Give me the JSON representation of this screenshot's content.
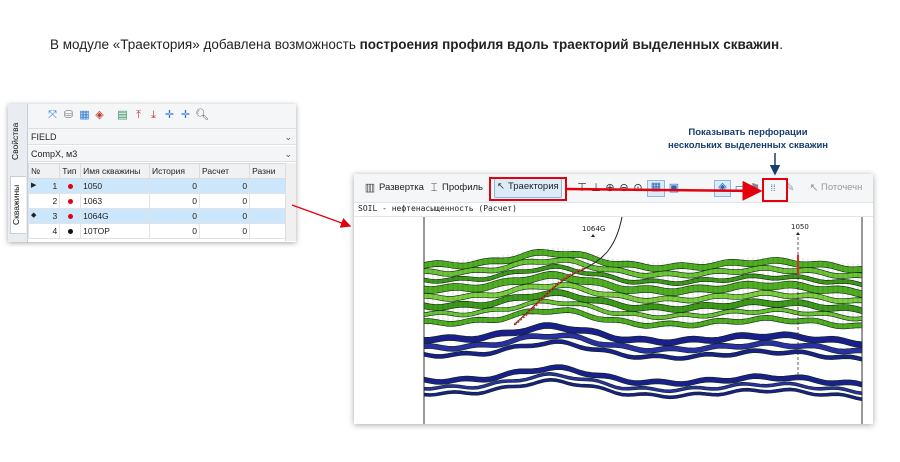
{
  "headline": {
    "prefix": "В модуле «Траектория» добавлена возможность ",
    "bold": "построения профиля вдоль траекторий выделенных скважин",
    "suffix": "."
  },
  "wells_panel": {
    "tabs": {
      "properties": "Свойства",
      "wells": "Скважины"
    },
    "combo_field": "FIELD",
    "combo_property": "CompX, м3",
    "columns": {
      "no": "№",
      "type": "Тип",
      "name": "Имя скважины",
      "history": "История",
      "calc": "Расчет",
      "diff": "Разни"
    },
    "rows": [
      {
        "no": "1",
        "name": "1050",
        "history": "0",
        "calc": "0",
        "dot_color": "#e3000f"
      },
      {
        "no": "2",
        "name": "1063",
        "history": "0",
        "calc": "0",
        "dot_color": "#e3000f"
      },
      {
        "no": "3",
        "name": "1064G",
        "history": "0",
        "calc": "0",
        "dot_color": "#e3000f"
      },
      {
        "no": "4",
        "name": "10TOP",
        "history": "0",
        "calc": "0",
        "dot_color": "#111111"
      }
    ]
  },
  "profile": {
    "toolbar": {
      "sweep": "Развертка",
      "profile": "Профиль",
      "trajectory": "Траектория",
      "streamlines": "Поточечн"
    },
    "property_line": "SOIL     - нефтенасыщенность (Расчет)",
    "well_labels": {
      "left": "1064G",
      "right": "1050"
    }
  },
  "annotation": {
    "line1": "Показывать перфорации",
    "line2": "нескольких выделенных скважин"
  },
  "colors": {
    "highlight_red": "#e3000f",
    "annotation_blue": "#173c6e",
    "green_layer": "#4fae22",
    "blue_layer": "#1a1f8c",
    "selection_blue": "#cce6fb"
  }
}
